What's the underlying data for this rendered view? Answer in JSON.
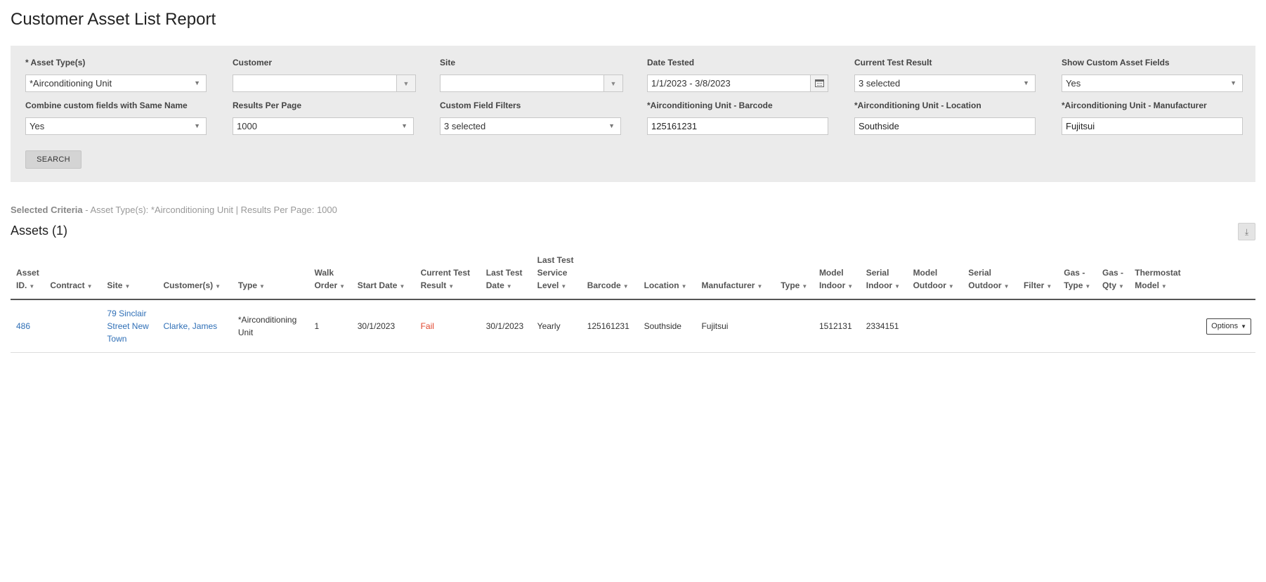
{
  "page": {
    "title": "Customer Asset List Report"
  },
  "filters": {
    "asset_type": {
      "label": "* Asset Type(s)",
      "value": "*Airconditioning Unit"
    },
    "customer": {
      "label": "Customer",
      "value": ""
    },
    "site": {
      "label": "Site",
      "value": ""
    },
    "date_tested": {
      "label": "Date Tested",
      "value": "1/1/2023 - 3/8/2023"
    },
    "current_test_result": {
      "label": "Current Test Result",
      "value": "3 selected"
    },
    "show_custom_fields": {
      "label": "Show Custom Asset Fields",
      "value": "Yes"
    },
    "combine_custom": {
      "label": "Combine custom fields with Same Name",
      "value": "Yes"
    },
    "results_per_page": {
      "label": "Results Per Page",
      "value": "1000"
    },
    "custom_field_filters": {
      "label": "Custom Field Filters",
      "value": "3 selected"
    },
    "barcode": {
      "label": "*Airconditioning Unit - Barcode",
      "value": "125161231"
    },
    "location": {
      "label": "*Airconditioning Unit - Location",
      "value": "Southside"
    },
    "manufacturer": {
      "label": "*Airconditioning Unit - Manufacturer",
      "value": "Fujitsui"
    },
    "search_label": "SEARCH"
  },
  "criteria": {
    "label": "Selected Criteria",
    "text": " - Asset Type(s): *Airconditioning Unit | Results Per Page: 1000"
  },
  "assets": {
    "title": "Assets (1)",
    "columns": [
      [
        "Asset",
        "ID."
      ],
      [
        "Contract"
      ],
      [
        "Site"
      ],
      [
        "Customer(s)"
      ],
      [
        "Type"
      ],
      [
        "Walk",
        "Order"
      ],
      [
        "Start Date"
      ],
      [
        "Current Test",
        "Result"
      ],
      [
        "Last Test",
        "Date"
      ],
      [
        "Last Test",
        "Service",
        "Level"
      ],
      [
        "Barcode"
      ],
      [
        "Location"
      ],
      [
        "Manufacturer"
      ],
      [
        "Type"
      ],
      [
        "Model",
        "Indoor"
      ],
      [
        "Serial",
        "Indoor"
      ],
      [
        "Model",
        "Outdoor"
      ],
      [
        "Serial",
        "Outdoor"
      ],
      [
        "Filter"
      ],
      [
        "Gas -",
        "Type"
      ],
      [
        "Gas -",
        "Qty"
      ],
      [
        "Thermostat",
        "Model"
      ],
      [
        ""
      ]
    ],
    "rows": [
      {
        "asset_id": "486",
        "contract": "",
        "site": [
          "79 Sinclair",
          "Street New",
          "Town"
        ],
        "customer": "Clarke, James",
        "type": [
          "*Airconditioning",
          "Unit"
        ],
        "walk_order": "1",
        "start_date": "30/1/2023",
        "current_test_result": "Fail",
        "last_test_date": "30/1/2023",
        "service_level": "Yearly",
        "barcode": "125161231",
        "location": "Southside",
        "manufacturer": "Fujitsui",
        "type2": "",
        "model_indoor": "1512131",
        "serial_indoor": "2334151",
        "model_outdoor": "",
        "serial_outdoor": "",
        "filter": "",
        "gas_type": "",
        "gas_qty": "",
        "thermostat_model": "",
        "options_label": "Options"
      }
    ]
  },
  "colors": {
    "link": "#2f6fb6",
    "fail": "#e0442c",
    "panel_bg": "#ebebeb"
  }
}
